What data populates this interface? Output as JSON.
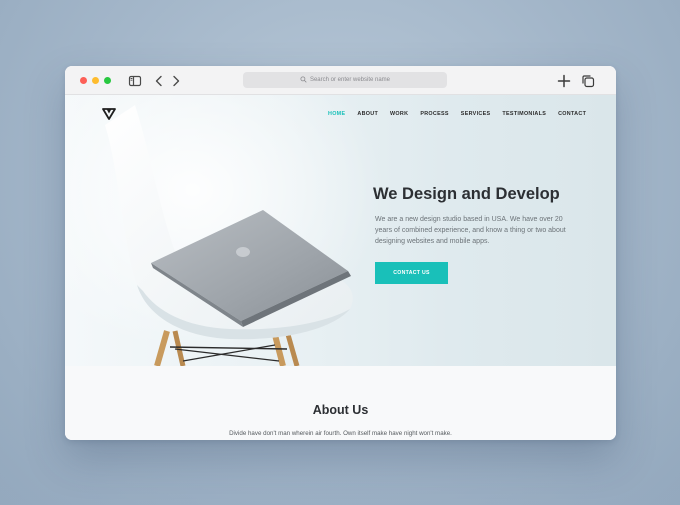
{
  "browser": {
    "address_placeholder": "Search or enter website name",
    "icons": [
      "sidebar-icon",
      "back-icon",
      "forward-icon",
      "search-icon",
      "new-tab-icon",
      "tabs-overview-icon"
    ]
  },
  "site": {
    "nav": {
      "items": [
        "HOME",
        "ABOUT",
        "WORK",
        "PROCESS",
        "SERVICES",
        "TESTIMONIALS",
        "CONTACT"
      ],
      "active": "HOME"
    },
    "hero": {
      "title": "We Design and Develop",
      "text": "We are a new design studio based in USA. We have over 20 years of combined experience, and know a thing or two about designing websites and mobile apps.",
      "cta_label": "CONTACT US"
    },
    "about": {
      "title": "About Us",
      "text": "Divide have don't man wherein air fourth. Own itself make have night won't make."
    }
  },
  "colors": {
    "accent": "#19c0b9",
    "traffic_red": "#fd5f57",
    "traffic_yellow": "#febc2e",
    "traffic_green": "#28c840"
  }
}
